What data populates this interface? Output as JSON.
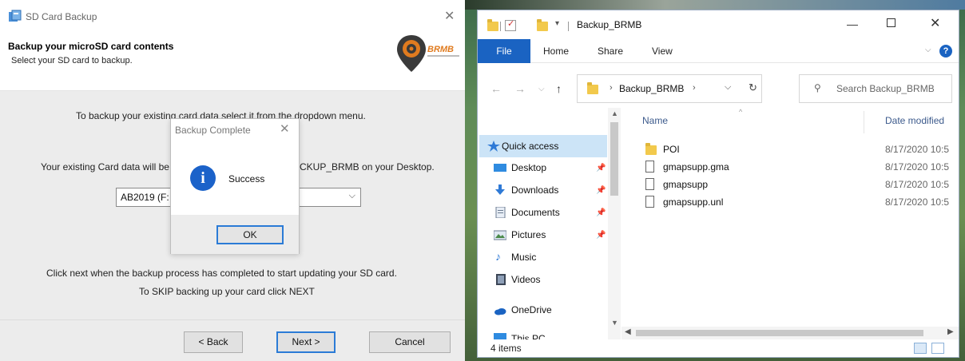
{
  "wizard": {
    "title": "SD Card Backup",
    "heading": "Backup your microSD card contents",
    "subheading": "Select your SD card to backup.",
    "logo_text": "BRMB",
    "instruction_1": "To backup your existing card data select it from the dropdown menu.",
    "instruction_2a": "Your existing Card data will be",
    "instruction_2b": "CKUP_BRMB on your Desktop.",
    "select_value": "AB2019 (F:",
    "instruction_3": "Click next when the backup process has completed to start updating your SD card.",
    "instruction_4": "To SKIP backing up your card click NEXT",
    "buttons": {
      "back": "< Back",
      "next": "Next >",
      "cancel": "Cancel"
    }
  },
  "modal": {
    "title": "Backup Complete",
    "message": "Success",
    "ok": "OK",
    "info_glyph": "i"
  },
  "explorer": {
    "title": "Backup_BRMB",
    "ribbon": {
      "file": "File",
      "home": "Home",
      "share": "Share",
      "view": "View"
    },
    "address": {
      "path": "Backup_BRMB"
    },
    "search_placeholder": "Search Backup_BRMB",
    "nav": {
      "quick_access": "Quick access",
      "desktop": "Desktop",
      "downloads": "Downloads",
      "documents": "Documents",
      "pictures": "Pictures",
      "music": "Music",
      "videos": "Videos",
      "onedrive": "OneDrive",
      "thispc": "This PC"
    },
    "columns": {
      "name": "Name",
      "date": "Date modified"
    },
    "files": [
      {
        "name": "POI",
        "date": "8/17/2020 10:5",
        "type": "folder"
      },
      {
        "name": "gmapsupp.gma",
        "date": "8/17/2020 10:5",
        "type": "file"
      },
      {
        "name": "gmapsupp",
        "date": "8/17/2020 10:5",
        "type": "file"
      },
      {
        "name": "gmapsupp.unl",
        "date": "8/17/2020 10:5",
        "type": "file"
      }
    ],
    "status": "4 items"
  },
  "colors": {
    "accent_blue": "#1a63c2",
    "info_blue": "#1b62c9",
    "selection": "#cce4f7",
    "folder_yellow": "#f2c94c"
  }
}
